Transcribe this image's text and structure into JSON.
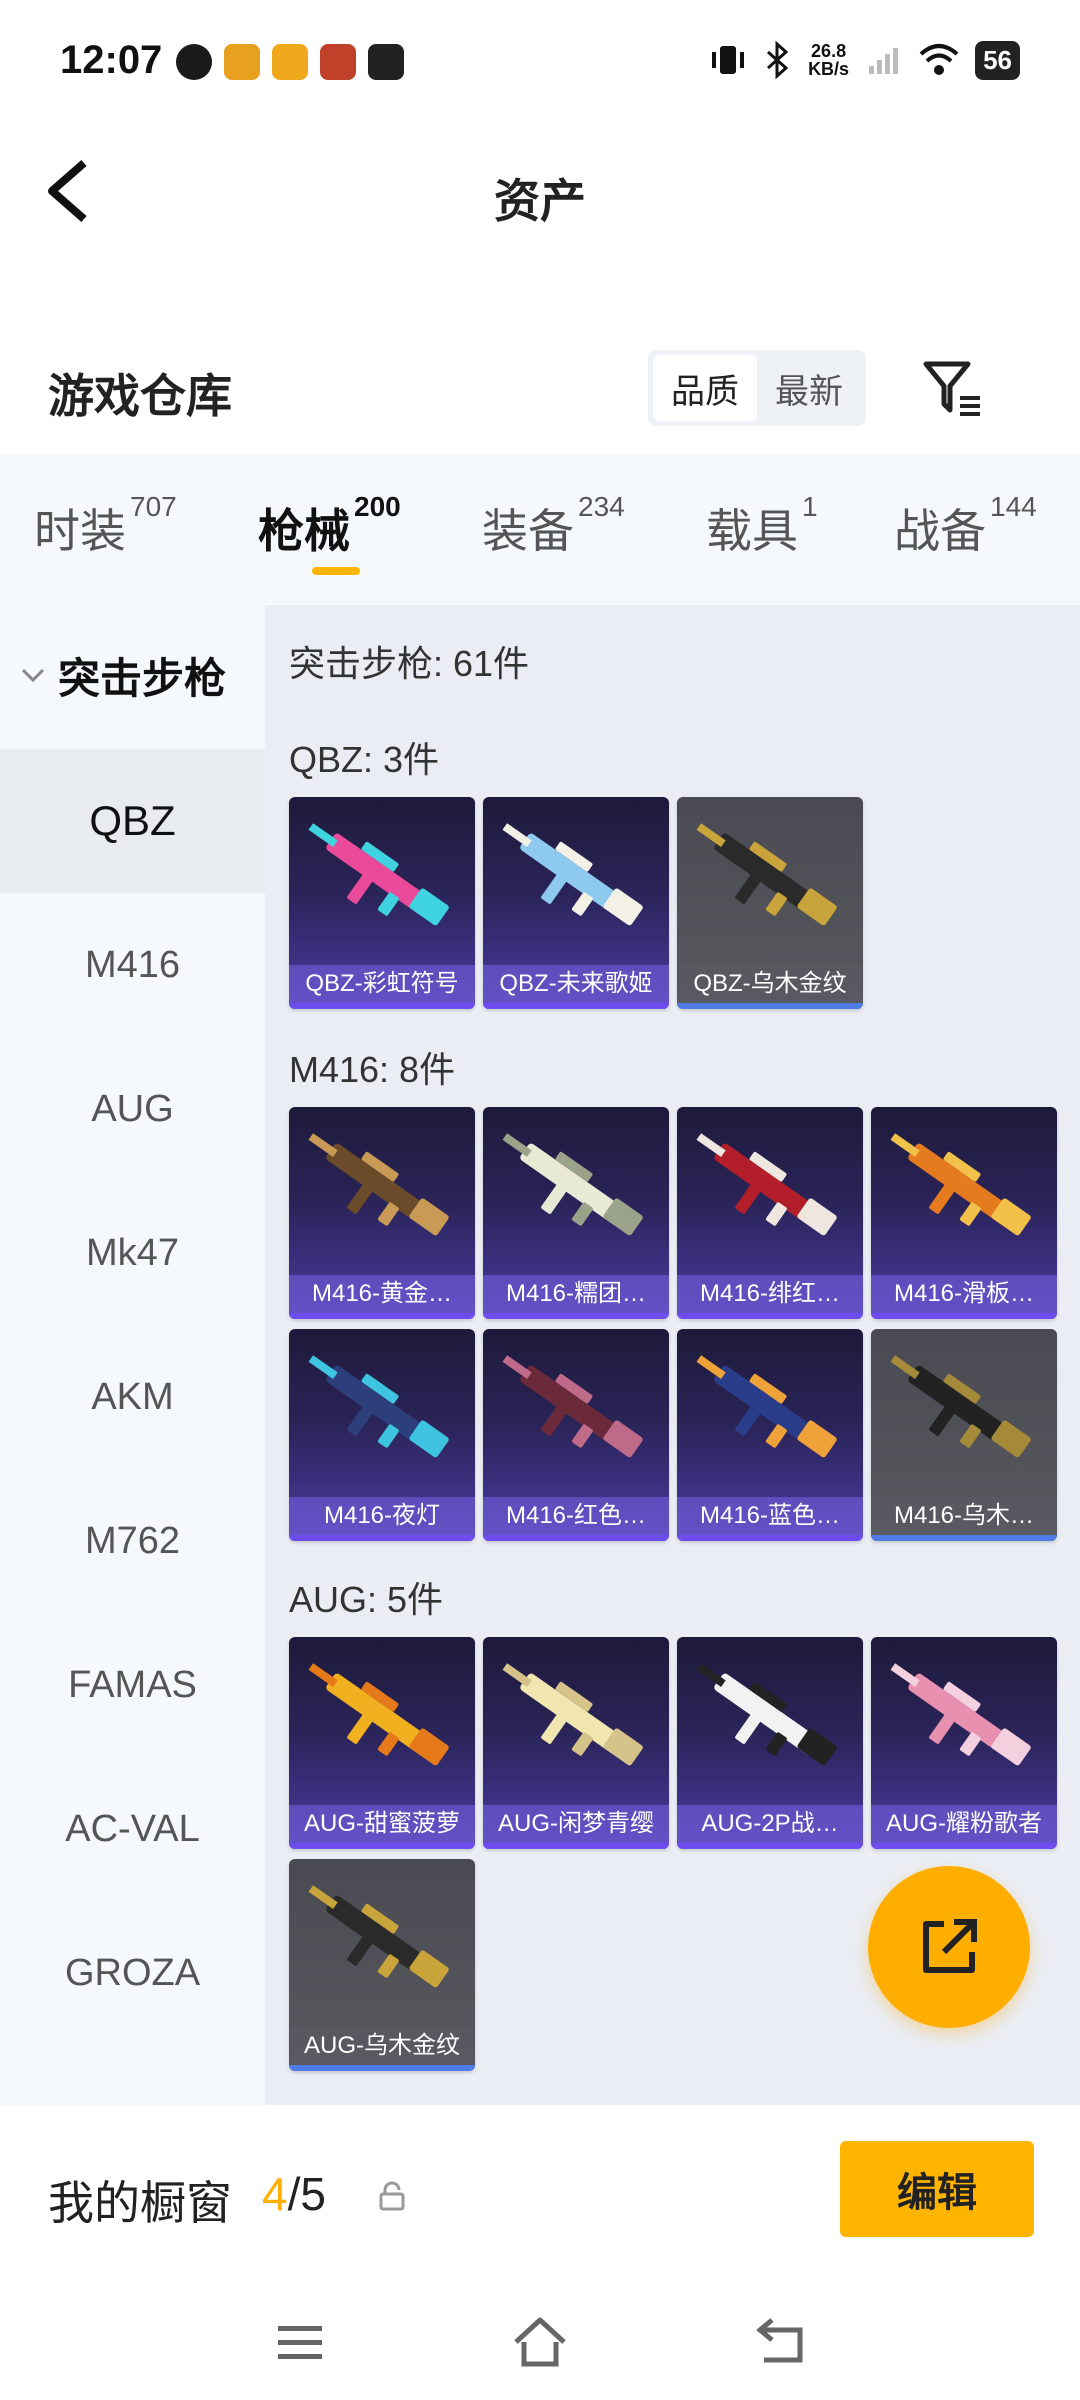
{
  "status_bar": {
    "time": "12:07",
    "net_speed_value": "26.8",
    "net_speed_unit": "KB/s",
    "battery": "56"
  },
  "header": {
    "title": "资产"
  },
  "warehouse": {
    "title": "游戏仓库",
    "sort_options": [
      "品质",
      "最新"
    ],
    "active_sort": "品质"
  },
  "tabs": [
    {
      "label": "时装",
      "count": "707"
    },
    {
      "label": "枪械",
      "count": "200"
    },
    {
      "label": "装备",
      "count": "234"
    },
    {
      "label": "载具",
      "count": "1"
    },
    {
      "label": "战备",
      "count": "144"
    }
  ],
  "sidebar": {
    "group": "突击步枪",
    "items": [
      "QBZ",
      "M416",
      "AUG",
      "Mk47",
      "AKM",
      "M762",
      "FAMAS",
      "AC-VAL",
      "GROZA"
    ]
  },
  "content": {
    "summary": "突击步枪: 61件",
    "sections": [
      {
        "label": "QBZ: 3件",
        "items": [
          {
            "name": "QBZ-彩虹符号",
            "grey": false,
            "body": "#e94b9a",
            "accent": "#3fd3e0"
          },
          {
            "name": "QBZ-未来歌姬",
            "grey": false,
            "body": "#8ec9f0",
            "accent": "#f3f0e6"
          },
          {
            "name": "QBZ-乌木金纹",
            "grey": true,
            "body": "#2a2a2a",
            "accent": "#c9a43a"
          }
        ]
      },
      {
        "label": "M416: 8件",
        "items": [
          {
            "name": "M416-黄金…",
            "grey": false,
            "body": "#6b4b2a",
            "accent": "#c89a55"
          },
          {
            "name": "M416-糯团…",
            "grey": false,
            "body": "#e9ead6",
            "accent": "#9aa38a"
          },
          {
            "name": "M416-绯红…",
            "grey": false,
            "body": "#b21e2a",
            "accent": "#f0e6e0"
          },
          {
            "name": "M416-滑板…",
            "grey": false,
            "body": "#e57a1e",
            "accent": "#f2c14a"
          },
          {
            "name": "M416-夜灯",
            "grey": false,
            "body": "#2d3f7a",
            "accent": "#3ec3e0"
          },
          {
            "name": "M416-红色…",
            "grey": false,
            "body": "#6a2a3a",
            "accent": "#c06a8a"
          },
          {
            "name": "M416-蓝色…",
            "grey": false,
            "body": "#2a3d8a",
            "accent": "#f0a23a"
          },
          {
            "name": "M416-乌木…",
            "grey": true,
            "body": "#222222",
            "accent": "#a58a3a"
          }
        ]
      },
      {
        "label": "AUG: 5件",
        "items": [
          {
            "name": "AUG-甜蜜菠萝",
            "grey": false,
            "body": "#f0b020",
            "accent": "#e67a1a"
          },
          {
            "name": "AUG-闲梦青缨",
            "grey": false,
            "body": "#f1e6b0",
            "accent": "#d6c38a"
          },
          {
            "name": "AUG-2P战…",
            "grey": false,
            "body": "#f2f2f2",
            "accent": "#222222"
          },
          {
            "name": "AUG-耀粉歌者",
            "grey": false,
            "body": "#e890b0",
            "accent": "#f4d0de"
          },
          {
            "name": "AUG-乌木金纹",
            "grey": true,
            "body": "#2a2a2a",
            "accent": "#c9a43a"
          }
        ]
      }
    ]
  },
  "showcase": {
    "label": "我的橱窗",
    "current": "4",
    "total": "/5",
    "edit_label": "编辑"
  },
  "colors": {
    "accent": "#ffb400",
    "tab_indicator": "#ffb400"
  }
}
